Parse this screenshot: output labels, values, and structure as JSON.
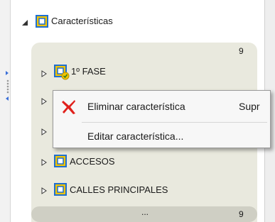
{
  "tree": {
    "root": {
      "label": "Características"
    },
    "group": {
      "top_count": "9",
      "footer_ellipsis": "...",
      "footer_count": "9"
    },
    "items": [
      {
        "label": "1º FASE"
      },
      {
        "label": ""
      },
      {
        "label": ""
      },
      {
        "label": "ACCESOS"
      },
      {
        "label": "CALLES PRINCIPALES"
      }
    ]
  },
  "context_menu": {
    "items": [
      {
        "label": "Eliminar característica",
        "shortcut": "Supr",
        "icon": "delete-x-icon"
      },
      {
        "label": "Editar característica...",
        "shortcut": ""
      }
    ]
  },
  "colors": {
    "layer_icon_fill": "#f2c400",
    "layer_icon_frame": "#1f6fd1",
    "delete_red": "#e0201b",
    "panel_bg": "#e9e9de"
  }
}
